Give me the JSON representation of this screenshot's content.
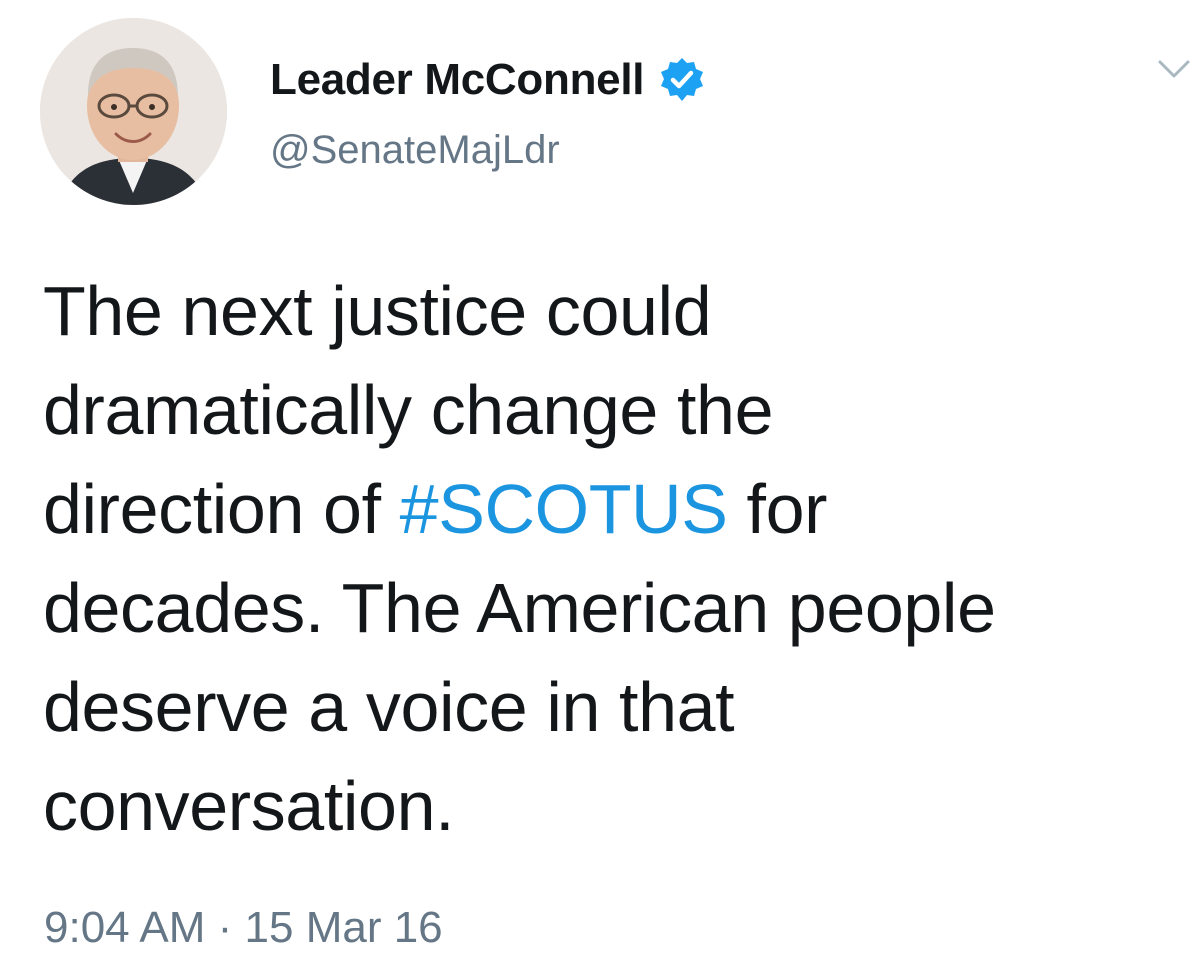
{
  "tweet": {
    "author": {
      "display_name": "Leader McConnell",
      "handle": "@SenateMajLdr",
      "verified": true,
      "avatar_icon": "profile-photo"
    },
    "menu_icon": "chevron-down-icon",
    "text": {
      "line1": "The next justice could",
      "line2": "dramatically change the",
      "line3_before": "direction of ",
      "hashtag": "#SCOTUS",
      "line3_after": " for",
      "line4": "decades. The American people",
      "line5": "deserve a voice in that",
      "line6": "conversation."
    },
    "timestamp": "9:04 AM · 15 Mar 16"
  },
  "colors": {
    "text": "#14171a",
    "secondary": "#657786",
    "link": "#1b95e0",
    "verified": "#1da1f2"
  }
}
